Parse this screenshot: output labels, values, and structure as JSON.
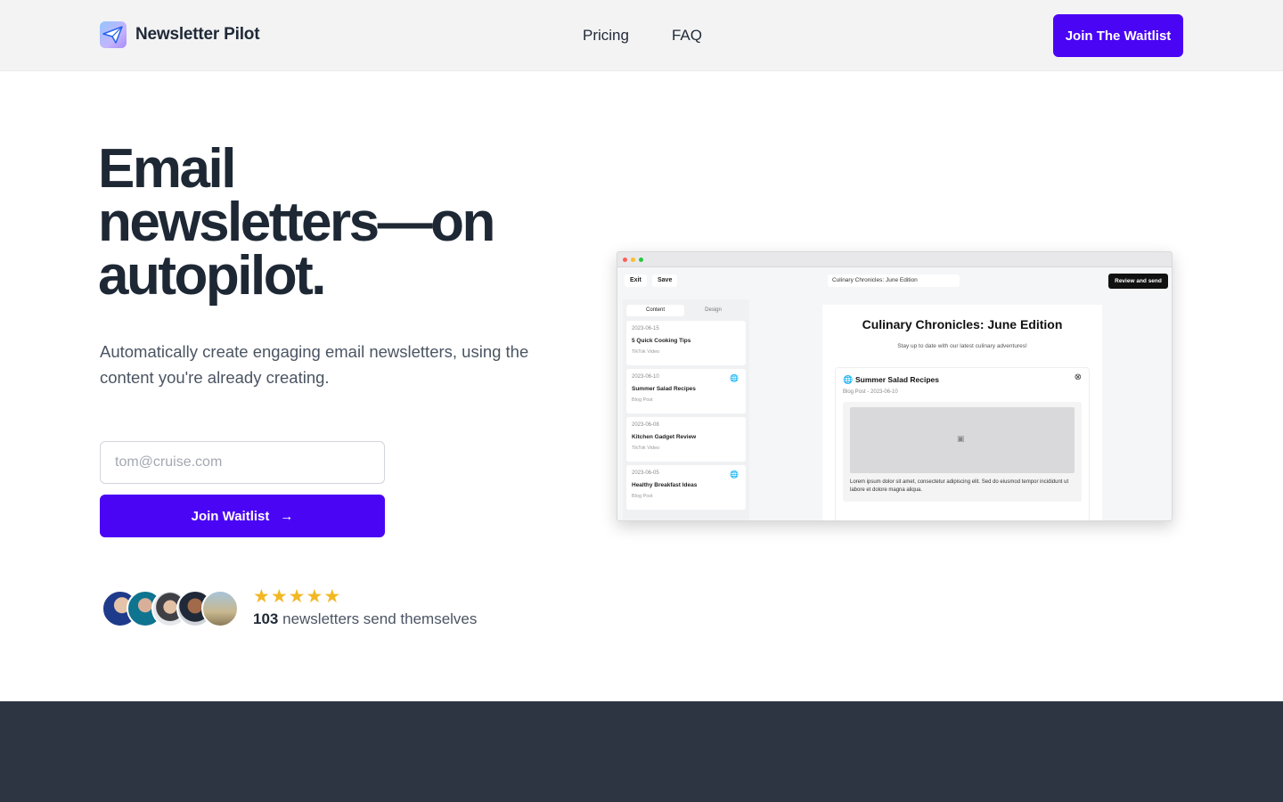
{
  "header": {
    "brand_name": "Newsletter Pilot",
    "nav": [
      "Pricing",
      "FAQ"
    ],
    "cta_label": "Join The Waitlist"
  },
  "hero": {
    "title_lines": [
      "Email",
      "newsletters—on",
      "autopilot."
    ],
    "subtitle": "Automatically create engaging email newsletters, using the content you're already creating.",
    "email_placeholder": "tom@cruise.com",
    "join_label": "Join Waitlist",
    "join_arrow": "→"
  },
  "social_proof": {
    "stars": [
      "★",
      "★",
      "★",
      "★",
      "★"
    ],
    "count": "103",
    "text": "newsletters send themselves"
  },
  "preview": {
    "toolbar": {
      "exit": "Exit",
      "save": "Save",
      "doc_title": "Culinary Chronicles: June Edition",
      "review": "Review and send"
    },
    "tabs": [
      "Content",
      "Design"
    ],
    "items": [
      {
        "date": "2023-06-15",
        "title": "5 Quick Cooking Tips",
        "type": "TikTok Video",
        "globe": ""
      },
      {
        "date": "2023-06-10",
        "title": "Summer Salad Recipes",
        "type": "Blog Post",
        "globe": "🌐"
      },
      {
        "date": "2023-06-08",
        "title": "Kitchen Gadget Review",
        "type": "TikTok Video",
        "globe": ""
      },
      {
        "date": "2023-06-05",
        "title": "Healthy Breakfast Ideas",
        "type": "Blog Post",
        "globe": "🌐"
      }
    ],
    "doc": {
      "title": "Culinary Chronicles: June Edition",
      "subtitle": "Stay up to date with our latest culinary adventures!",
      "card_title": "Summer Salad Recipes",
      "card_meta": "Blog Post - 2023-06-10",
      "card_body": "Lorem ipsum dolor sit amet, consectetur adipiscing elit. Sed do eiusmod tempor incididunt ut labore et dolore magna aliqua."
    }
  },
  "colors": {
    "accent": "#4a05f5",
    "star": "#f2b824",
    "dark_band": "#2d3543",
    "header_bg": "#f3f3f4"
  }
}
